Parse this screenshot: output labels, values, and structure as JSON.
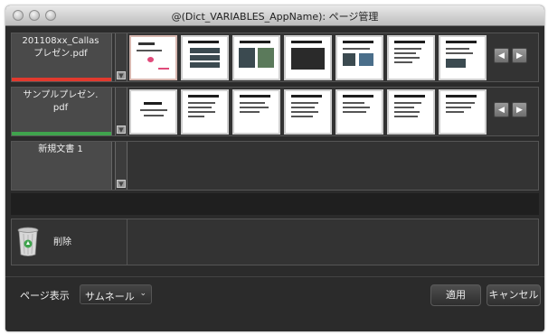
{
  "window": {
    "title": "@(Dict_VARIABLES_AppName): ページ管理"
  },
  "documents": [
    {
      "name": "201108xx_Callas\nプレゼン.pdf",
      "bar_color": "#e23a2e",
      "thumbnail_count": 7,
      "first_thumbnail_active": true
    },
    {
      "name": "サンプルプレゼン.\npdf",
      "bar_color": "#3fa34d",
      "thumbnail_count": 7,
      "first_thumbnail_active": false
    },
    {
      "name": "新規文書 1",
      "bar_color": "",
      "thumbnail_count": 0,
      "first_thumbnail_active": false
    }
  ],
  "nav": {
    "prev_icon": "◀",
    "next_icon": "▶"
  },
  "trash": {
    "label": "削除"
  },
  "bottom": {
    "view_label": "ページ表示",
    "view_value": "サムネール",
    "view_arrow": "⌄",
    "apply_label": "適用",
    "cancel_label": "キャンセル"
  },
  "colors": {
    "background": "#2b2b2b",
    "row_label": "#4a4a4a",
    "red_bar": "#e23a2e",
    "green_bar": "#3fa34d"
  }
}
